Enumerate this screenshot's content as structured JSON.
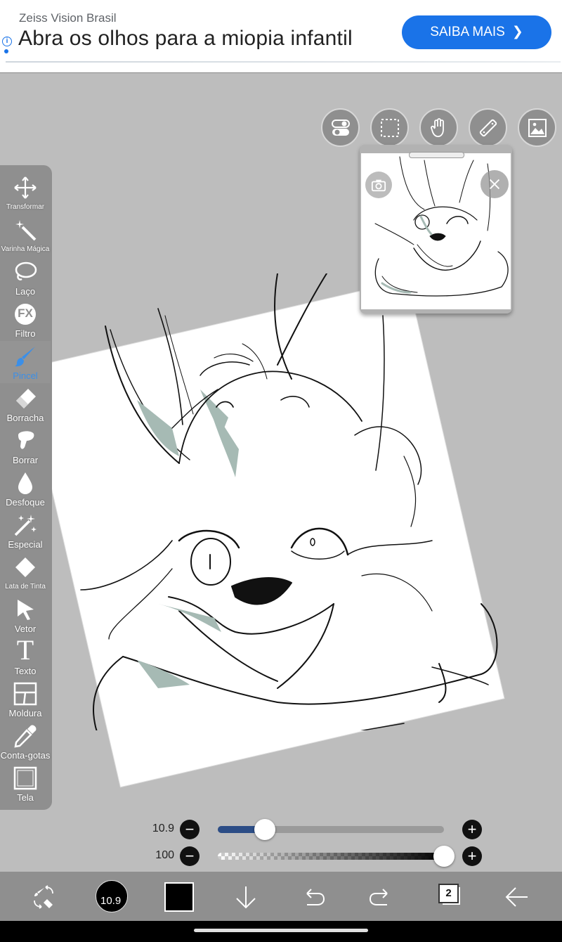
{
  "ad": {
    "sponsor": "Zeiss Vision Brasil",
    "headline": "Abra os olhos para a miopia infantil",
    "cta": "SAIBA MAIS",
    "cta_chevron": "❯",
    "info_icon": "i",
    "accent": "#1a73e8"
  },
  "quick_tools": [
    {
      "name": "toggle-icon"
    },
    {
      "name": "selection-icon"
    },
    {
      "name": "hand-icon"
    },
    {
      "name": "ruler-icon"
    },
    {
      "name": "image-icon"
    }
  ],
  "toolbar": {
    "transform": "Transformar",
    "magic_wand": "Varinha Mágica",
    "lasso": "Laço",
    "filter": "Filtro",
    "filter_badge": "FX",
    "brush": "Pincel",
    "eraser": "Borracha",
    "smudge": "Borrar",
    "blur": "Desfoque",
    "special": "Especial",
    "fill": "Lata de Tinta",
    "vector": "Vetor",
    "text": "Texto",
    "text_glyph": "T",
    "frame": "Moldura",
    "eyedropper": "Conta-gotas",
    "canvas": "Tela",
    "active_color": "#3b8fe8"
  },
  "sliders": {
    "size": {
      "label": "10.9",
      "fraction": 0.163
    },
    "opacity": {
      "label": "100",
      "fraction": 1.0
    },
    "minus": "−",
    "plus": "+"
  },
  "bottombar": {
    "brush_size": "10.9",
    "layer_count": "2",
    "color": "#000000"
  }
}
